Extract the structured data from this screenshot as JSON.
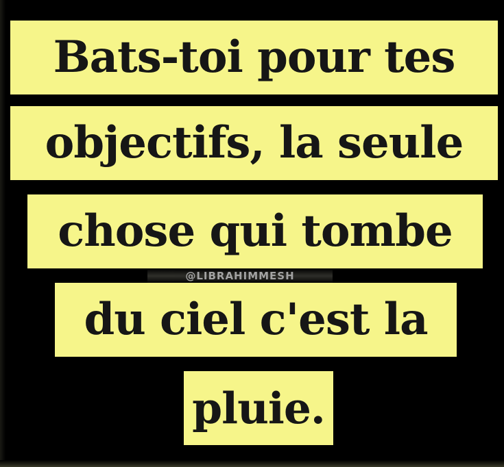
{
  "lines": [
    "Bats-toi pour tes",
    "objectifs, la seule",
    "chose qui tombe",
    "du ciel c'est la",
    "pluie."
  ],
  "watermark": "@LIBRAHIMMESH",
  "colors": {
    "background": "#000000",
    "highlight": "#f6f58a",
    "text": "#161616"
  }
}
